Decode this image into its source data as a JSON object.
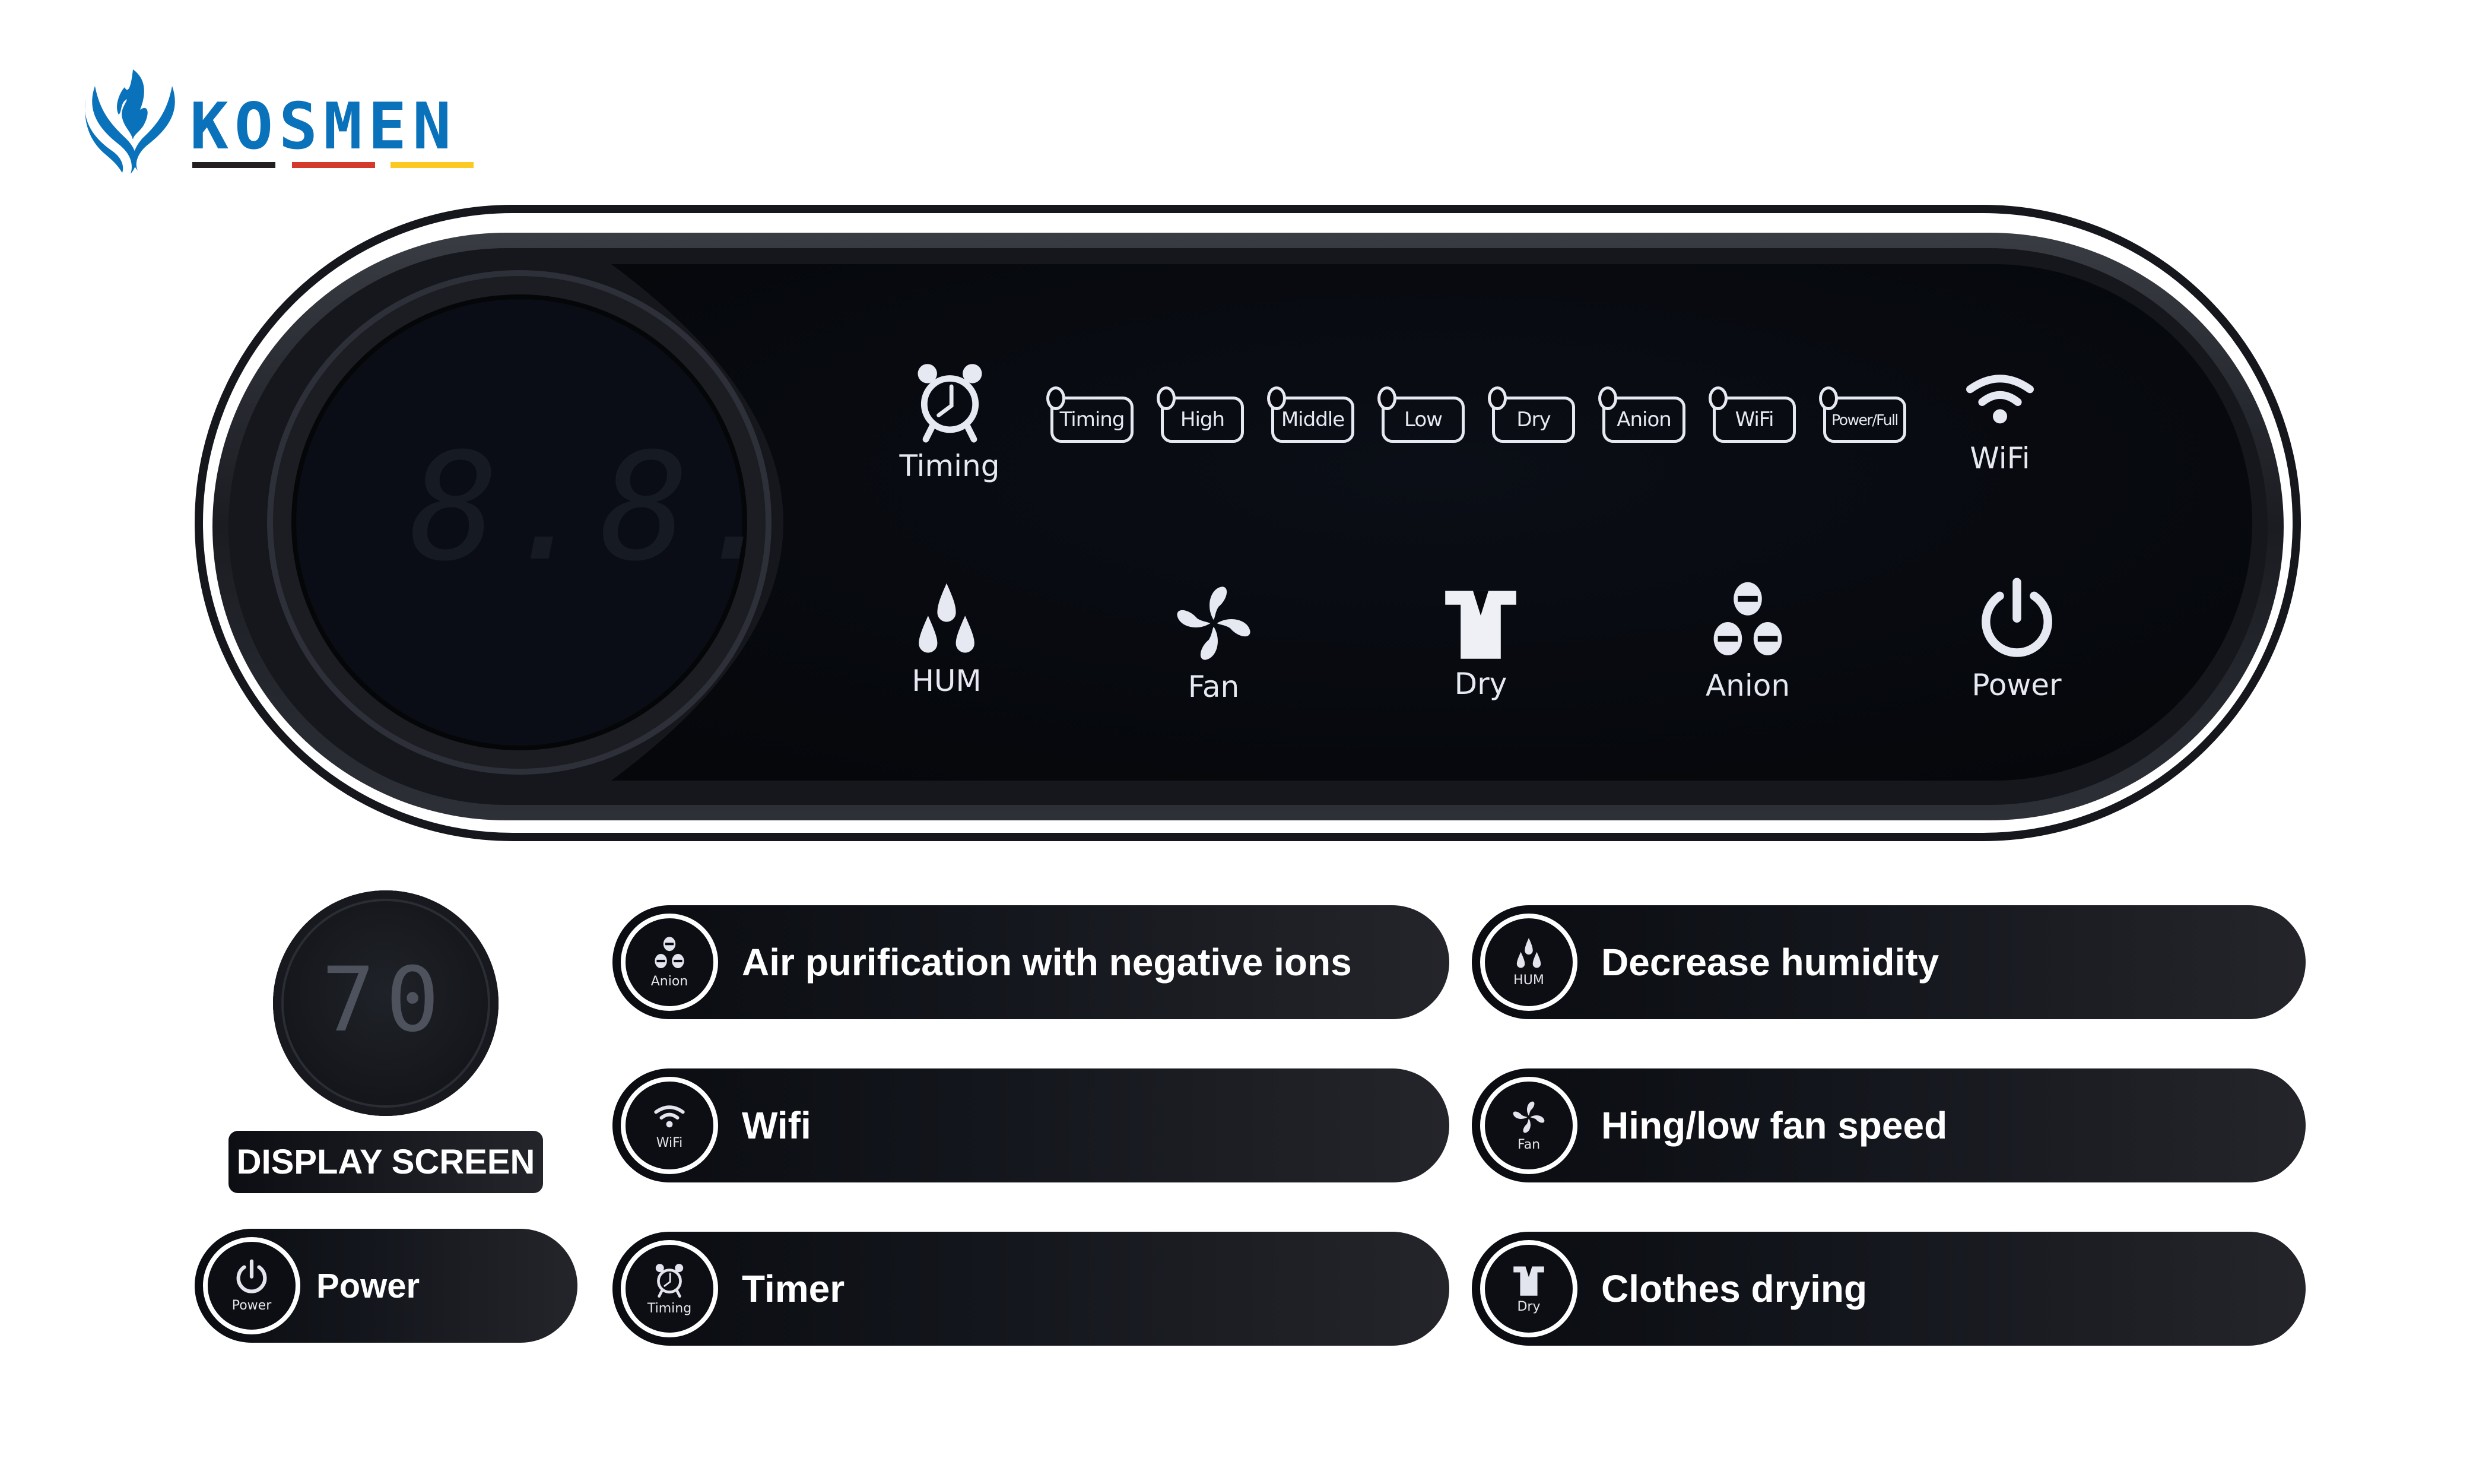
{
  "brand": {
    "name": "KOSMEN",
    "logo_icon": "phoenix-flame-icon",
    "colors": {
      "primary": "#0a72bb",
      "stripe_black": "#231f20",
      "stripe_red": "#d33a2c",
      "stripe_yellow": "#fcc923"
    }
  },
  "panel": {
    "display": {
      "value": "8.8.",
      "icon": "seven-segment-display"
    },
    "indicators": [
      {
        "label": "Timing"
      },
      {
        "label": "High"
      },
      {
        "label": "Middle"
      },
      {
        "label": "Low"
      },
      {
        "label": "Dry"
      },
      {
        "label": "Anion"
      },
      {
        "label": "WiFi"
      },
      {
        "label": "Power/Full"
      }
    ],
    "top_buttons": [
      {
        "label": "Timing",
        "icon": "alarm-clock-icon"
      },
      {
        "label": "WiFi",
        "icon": "wifi-icon"
      }
    ],
    "bottom_buttons": [
      {
        "label": "HUM",
        "icon": "water-drops-icon"
      },
      {
        "label": "Fan",
        "icon": "fan-icon"
      },
      {
        "label": "Dry",
        "icon": "shirt-icon"
      },
      {
        "label": "Anion",
        "icon": "negative-ions-icon"
      },
      {
        "label": "Power",
        "icon": "power-icon"
      }
    ]
  },
  "legend": {
    "display_screen": {
      "value": "70",
      "label": "DISPLAY SCREEN"
    },
    "items": [
      {
        "id": "power",
        "badge_label": "Power",
        "icon": "power-icon",
        "text": "Power"
      },
      {
        "id": "anion",
        "badge_label": "Anion",
        "icon": "negative-ions-icon",
        "text": "Air purification with negative ions"
      },
      {
        "id": "wifi",
        "badge_label": "WiFi",
        "icon": "wifi-icon",
        "text": "Wifi"
      },
      {
        "id": "timer",
        "badge_label": "Timing",
        "icon": "alarm-clock-icon",
        "text": "Timer"
      },
      {
        "id": "hum",
        "badge_label": "HUM",
        "icon": "water-drops-icon",
        "text": "Decrease humidity"
      },
      {
        "id": "fan",
        "badge_label": "Fan",
        "icon": "fan-icon",
        "text": "Hing/low fan speed"
      },
      {
        "id": "dry",
        "badge_label": "Dry",
        "icon": "shirt-icon",
        "text": "Clothes drying"
      }
    ]
  }
}
